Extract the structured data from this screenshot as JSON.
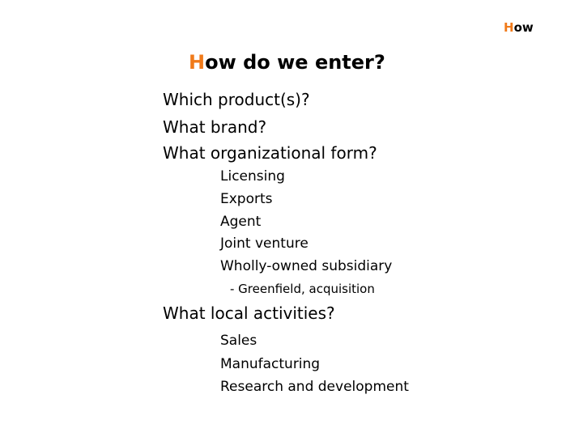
{
  "corner_label": {
    "initial": "H",
    "rest": "ow"
  },
  "title": {
    "initial": "H",
    "rest": "ow do we enter?"
  },
  "accent_color": "#f07a1a",
  "questions": [
    "Which product(s)?",
    "What brand?",
    "What organizational form?",
    "What local activities?"
  ],
  "organizational_forms": [
    "Licensing",
    "Exports",
    "Agent",
    "Joint venture",
    "Wholly-owned subsidiary"
  ],
  "subsidiary_detail": "- Greenfield, acquisition",
  "local_activities": [
    "Sales",
    "Manufacturing",
    "Research and development"
  ]
}
